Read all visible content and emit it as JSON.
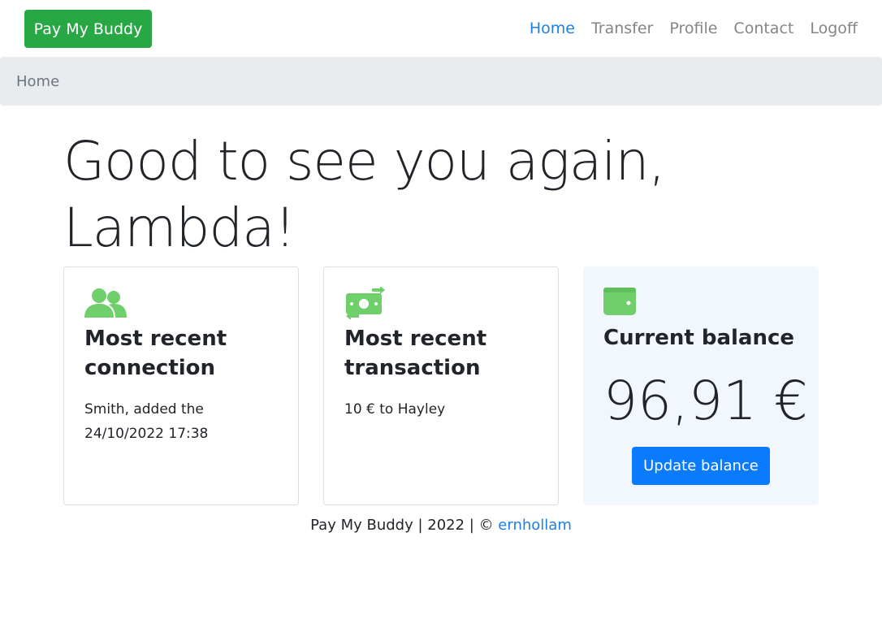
{
  "navbar": {
    "brand": "Pay My Buddy",
    "links": [
      "Home",
      "Transfer",
      "Profile",
      "Contact",
      "Logoff"
    ]
  },
  "breadcrumb": {
    "current": "Home"
  },
  "greeting": "Good to see you again, Lambda!",
  "cards": {
    "connection": {
      "icon": "users-icon",
      "title": "Most recent connection",
      "text": "Smith, added the 24/10/2022 17:38"
    },
    "transaction": {
      "icon": "money-exchange-icon",
      "title": "Most recent transaction",
      "text": "10 € to Hayley"
    },
    "balance": {
      "icon": "wallet-icon",
      "title": "Current balance",
      "amount": "96,91 €",
      "button_label": "Update balance"
    }
  },
  "footer": {
    "text": "Pay My Buddy | 2022 | © ",
    "link": "ernhollam"
  },
  "colors": {
    "brand": "#28a745",
    "icon_green": "#6fcf6a",
    "primary": "#0a7bff",
    "link": "#1f7fe0",
    "breadcrumb_bg": "#e9ecef",
    "balance_card_bg": "#f2f6fd"
  }
}
